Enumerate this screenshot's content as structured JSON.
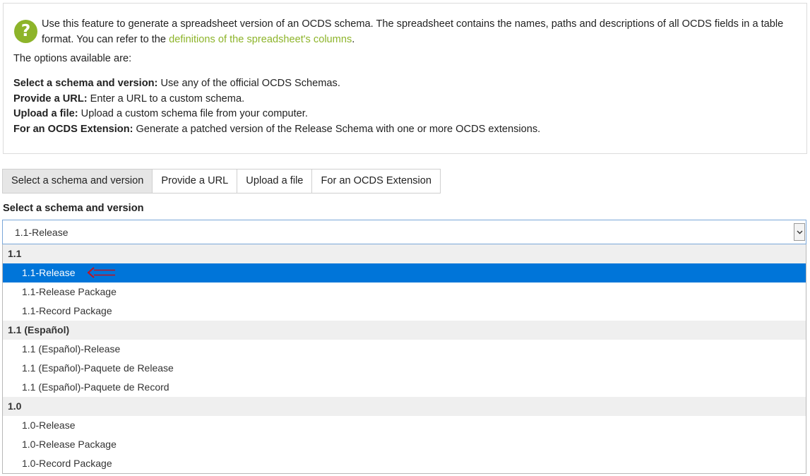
{
  "info": {
    "intro_text": "Use this feature to generate a spreadsheet version of an OCDS schema. The spreadsheet contains the names, paths and descriptions of all OCDS fields in a table format. You can refer to the ",
    "intro_link": "definitions of the spreadsheet's columns",
    "intro_end": ".",
    "options_title": "The options available are:",
    "options": [
      {
        "label": "Select a schema and version:",
        "desc": " Use any of the official OCDS Schemas."
      },
      {
        "label": "Provide a URL:",
        "desc": " Enter a URL to a custom schema."
      },
      {
        "label": "Upload a file:",
        "desc": " Upload a custom schema file from your computer."
      },
      {
        "label": "For an OCDS Extension:",
        "desc": " Generate a patched version of the Release Schema with one or more OCDS extensions."
      }
    ]
  },
  "tabs": [
    "Select a schema and version",
    "Provide a URL",
    "Upload a file",
    "For an OCDS Extension"
  ],
  "field_label": "Select a schema and version",
  "select": {
    "value": "1.1-Release",
    "groups": [
      {
        "label": "1.1",
        "options": [
          "1.1-Release",
          "1.1-Release Package",
          "1.1-Record Package"
        ]
      },
      {
        "label": "1.1 (Español)",
        "options": [
          "1.1 (Español)-Release",
          "1.1 (Español)-Paquete de Release",
          "1.1 (Español)-Paquete de Record"
        ]
      },
      {
        "label": "1.0",
        "options": [
          "1.0-Release",
          "1.0-Release Package",
          "1.0-Record Package"
        ]
      }
    ]
  },
  "colors": {
    "accent_green": "#8db42a",
    "selected_blue": "#0075d9",
    "arrow_red": "#c1121f"
  },
  "icons": {
    "help": "question-circle-icon",
    "dropdown": "chevron-down-icon",
    "annotation": "red-arrow-left-icon"
  }
}
